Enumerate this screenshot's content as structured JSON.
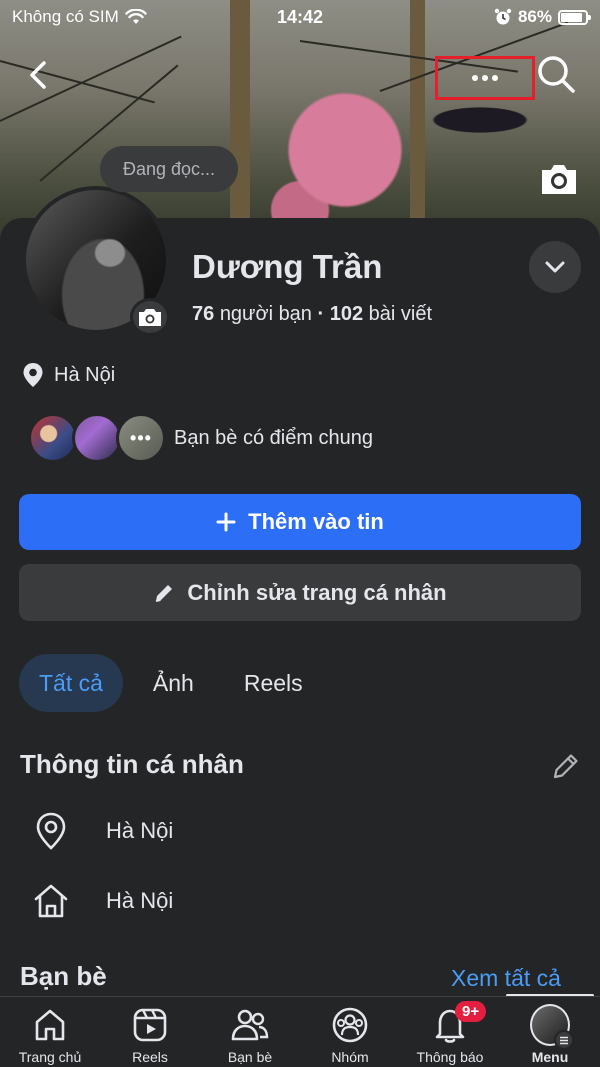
{
  "status_bar": {
    "carrier": "Không có SIM",
    "time": "14:42",
    "battery": "86%",
    "battery_level": 0.86
  },
  "cover": {
    "reading_label": "Đang đọc..."
  },
  "profile": {
    "name": "Dương Trần",
    "friends_count": "76",
    "friends_label": "người bạn",
    "separator": "·",
    "posts_count": "102",
    "posts_label": "bài viết",
    "location": "Hà Nội",
    "mutual_label": "Bạn bè có điểm chung"
  },
  "actions": {
    "add_story": "Thêm vào tin",
    "edit_profile": "Chỉnh sửa trang cá nhân"
  },
  "tabs": [
    {
      "label": "Tất cả",
      "active": true
    },
    {
      "label": "Ảnh",
      "active": false
    },
    {
      "label": "Reels",
      "active": false
    }
  ],
  "personal_info": {
    "title": "Thông tin cá nhân",
    "rows": [
      {
        "icon": "location-pin-icon",
        "text": "Hà Nội"
      },
      {
        "icon": "home-icon",
        "text": "Hà Nội"
      }
    ]
  },
  "friends_section": {
    "title": "Bạn bè",
    "see_all": "Xem tất cả"
  },
  "bottom_nav": {
    "items": [
      {
        "label": "Trang chủ",
        "icon": "home-icon"
      },
      {
        "label": "Reels",
        "icon": "reels-icon"
      },
      {
        "label": "Bạn bè",
        "icon": "friends-icon"
      },
      {
        "label": "Nhóm",
        "icon": "groups-icon"
      },
      {
        "label": "Thông báo",
        "icon": "bell-icon",
        "badge": "9+"
      },
      {
        "label": "Menu",
        "icon": "menu-avatar-icon",
        "active": true
      }
    ]
  },
  "colors": {
    "background": "#242526",
    "primary": "#2d6ef7",
    "link": "#4b9cf6",
    "badge": "#e41e3f",
    "highlight_box": "#e5202a"
  }
}
